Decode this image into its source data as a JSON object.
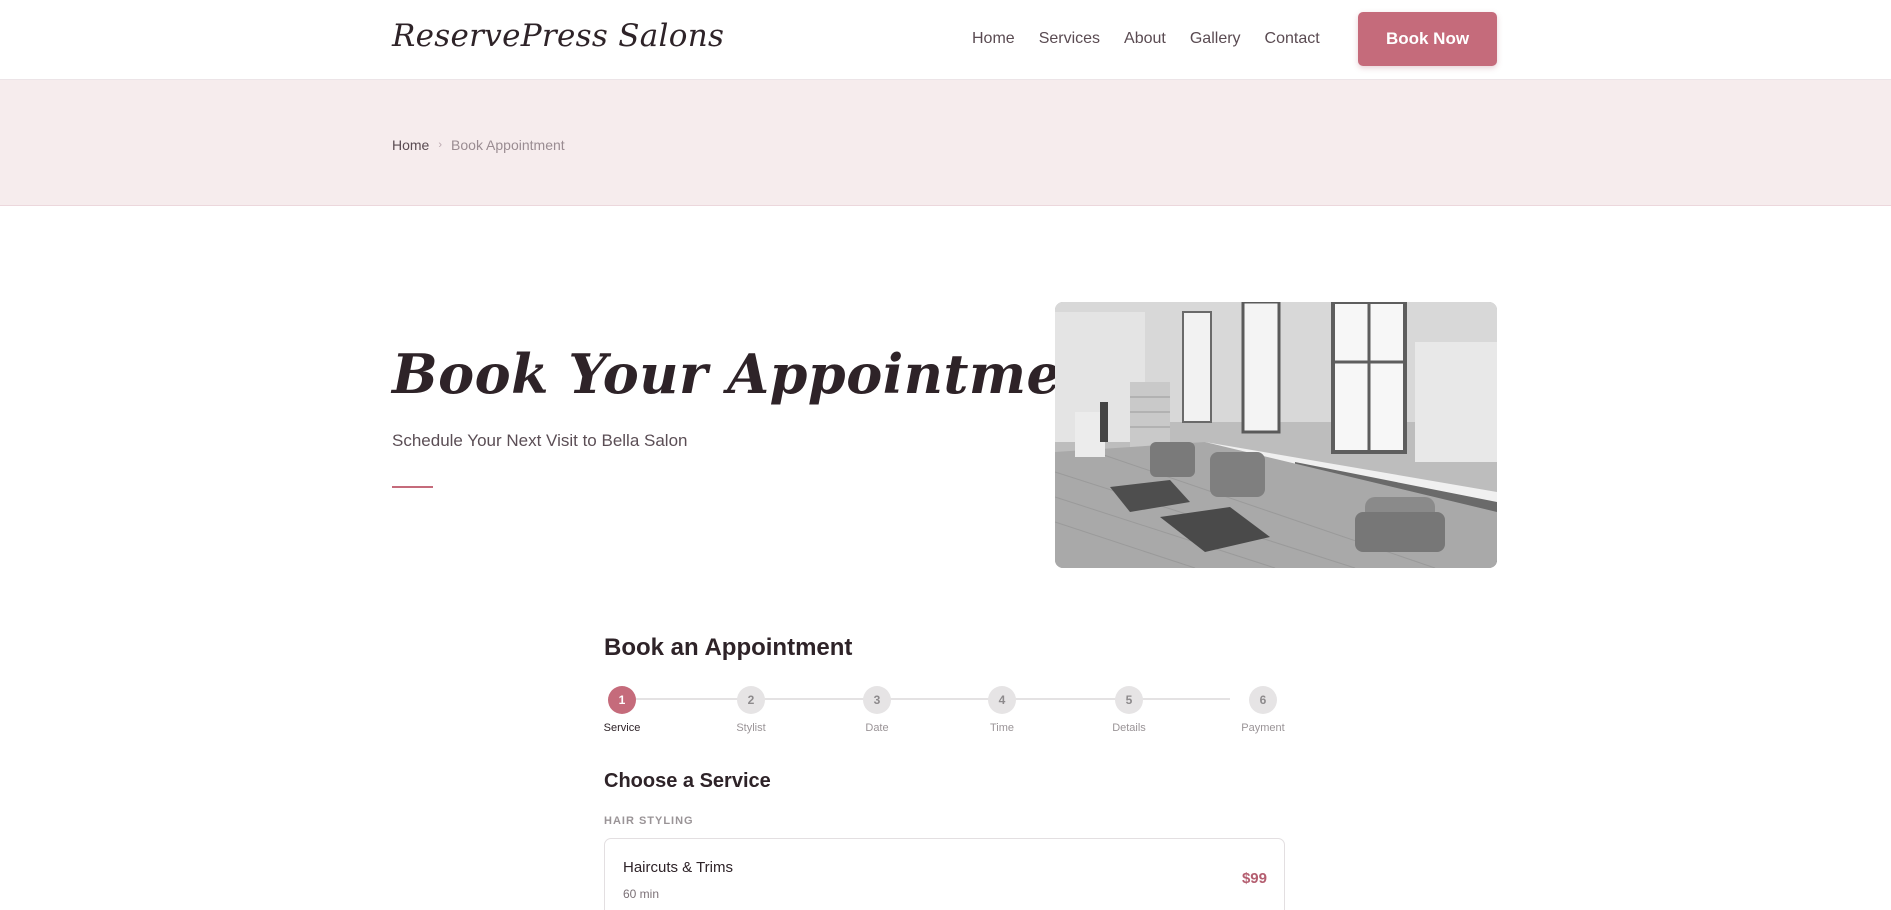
{
  "header": {
    "logo": "ReservePress Salons",
    "nav": [
      "Home",
      "Services",
      "About",
      "Gallery",
      "Contact"
    ],
    "book_button": "Book Now"
  },
  "breadcrumb": {
    "home": "Home",
    "separator": "›",
    "current": "Book Appointment"
  },
  "hero": {
    "title": "Book Your Appointment",
    "subtitle": "Schedule Your Next Visit to Bella Salon",
    "image": "salon-interior-photo"
  },
  "booking": {
    "title": "Book an Appointment",
    "steps": [
      {
        "number": "1",
        "label": "Service",
        "active": true
      },
      {
        "number": "2",
        "label": "Stylist",
        "active": false
      },
      {
        "number": "3",
        "label": "Date",
        "active": false
      },
      {
        "number": "4",
        "label": "Time",
        "active": false
      },
      {
        "number": "5",
        "label": "Details",
        "active": false
      },
      {
        "number": "6",
        "label": "Payment",
        "active": false
      }
    ],
    "section_title": "Choose a Service",
    "category": "HAIR STYLING",
    "services": [
      {
        "name": "Haircuts & Trims",
        "duration": "60 min",
        "price": "$99"
      }
    ]
  },
  "colors": {
    "accent": "#c56b7b",
    "band": "#f6eced",
    "text": "#2e2328"
  }
}
